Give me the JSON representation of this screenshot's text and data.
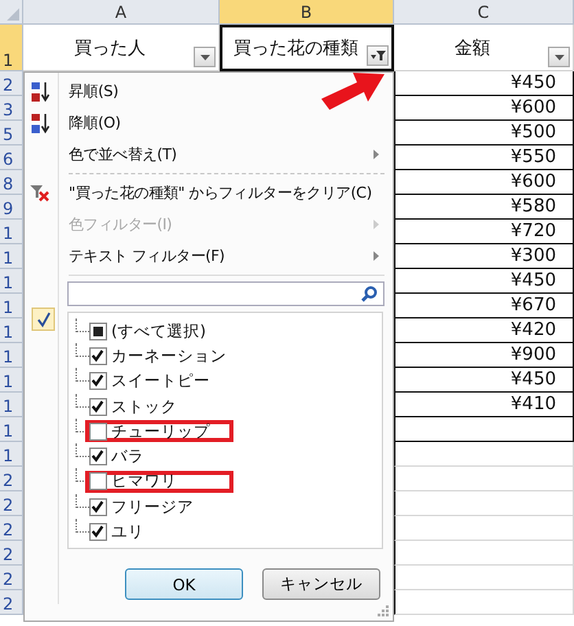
{
  "column_headers": [
    {
      "label": "A",
      "selected": false
    },
    {
      "label": "B",
      "selected": true
    },
    {
      "label": "C",
      "selected": false
    }
  ],
  "header_row": {
    "label": "1",
    "selected": true
  },
  "row_headers": [
    "2",
    "3",
    "5",
    "6",
    "8",
    "9",
    "1",
    "1",
    "1",
    "1",
    "1",
    "1",
    "1",
    "1",
    "1",
    "1",
    "2",
    "2",
    "2",
    "2",
    "2",
    "2"
  ],
  "header_cells": [
    {
      "text": "買った人",
      "filtered": false
    },
    {
      "text": "買った花の種類",
      "filtered": true
    },
    {
      "text": "金額",
      "filtered": false
    }
  ],
  "amounts": [
    "¥450",
    "¥600",
    "¥500",
    "¥550",
    "¥600",
    "¥580",
    "¥720",
    "¥300",
    "¥450",
    "¥670",
    "¥420",
    "¥900",
    "¥450",
    "¥410"
  ],
  "filter_menu": {
    "items": [
      {
        "kind": "sort-asc",
        "label": "昇順(S)",
        "disabled": false,
        "submenu": false
      },
      {
        "kind": "sort-desc",
        "label": "降順(O)",
        "disabled": false,
        "submenu": false
      },
      {
        "kind": "plain",
        "label": "色で並べ替え(T)",
        "disabled": false,
        "submenu": true
      },
      {
        "kind": "clear",
        "label": "\"買った花の種類\" からフィルターをクリア(C)",
        "disabled": false,
        "submenu": false
      },
      {
        "kind": "plain",
        "label": "色フィルター(I)",
        "disabled": true,
        "submenu": true
      },
      {
        "kind": "plain",
        "label": "テキスト フィルター(F)",
        "disabled": false,
        "submenu": true
      }
    ],
    "filter_applied": true,
    "values": [
      {
        "label": "(すべて選択)",
        "checked": false,
        "indeterminate": true,
        "highlighted": false
      },
      {
        "label": "カーネーション",
        "checked": true,
        "indeterminate": false,
        "highlighted": false
      },
      {
        "label": "スイートピー",
        "checked": true,
        "indeterminate": false,
        "highlighted": false
      },
      {
        "label": "ストック",
        "checked": true,
        "indeterminate": false,
        "highlighted": false
      },
      {
        "label": "チューリップ",
        "checked": false,
        "indeterminate": false,
        "highlighted": true
      },
      {
        "label": "バラ",
        "checked": true,
        "indeterminate": false,
        "highlighted": false
      },
      {
        "label": "ヒマワリ",
        "checked": false,
        "indeterminate": false,
        "highlighted": true
      },
      {
        "label": "フリージア",
        "checked": true,
        "indeterminate": false,
        "highlighted": false
      },
      {
        "label": "ユリ",
        "checked": true,
        "indeterminate": false,
        "highlighted": false
      }
    ],
    "buttons": [
      {
        "label": "OK",
        "default": true
      },
      {
        "label": "キャンセル",
        "default": false
      }
    ]
  }
}
